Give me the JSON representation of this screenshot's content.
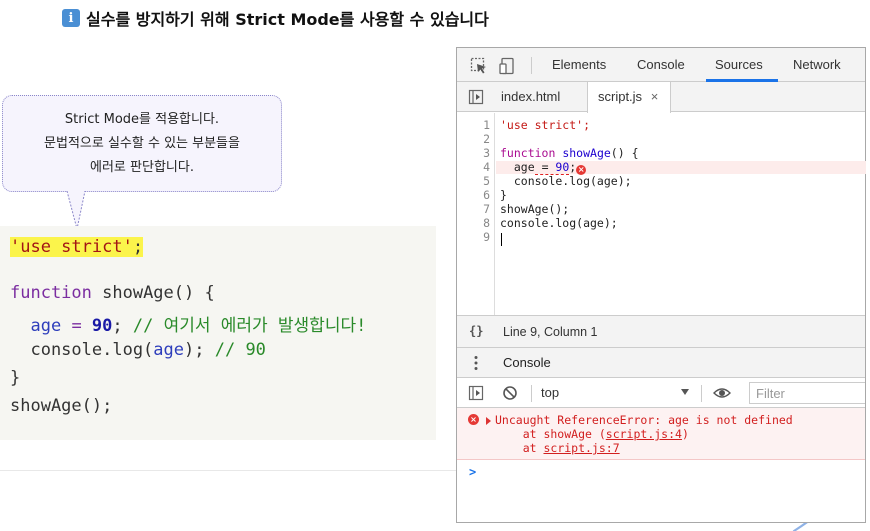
{
  "title": {
    "icon": "info-icon",
    "text": "실수를 방지하기 위해 Strict Mode를 사용할 수 있습니다"
  },
  "bubble": {
    "lines": [
      "Strict Mode를 적용합니다.",
      "문법적으로 실수할 수 있는 부분들을",
      "에러로 판단합니다."
    ]
  },
  "code": {
    "l1_str": "'use strict'",
    "l1_semi": ";",
    "l2_kw": "function",
    "l2_rest": " showAge() {",
    "l3_indent": "  ",
    "l3_var": "age",
    "l3_eq": " = ",
    "l3_num": "90",
    "l3_semi": "; ",
    "l3_cmt": "// 여기서 에러가 발생합니다!",
    "l4_a": "  console.log(",
    "l4_var": "age",
    "l4_b": "); ",
    "l4_cmt": "// 90",
    "l5": "}",
    "l6": "showAge();"
  },
  "devtools": {
    "tabs": [
      "Elements",
      "Console",
      "Sources",
      "Network"
    ],
    "active_tab": "Sources",
    "files": [
      "index.html",
      "script.js"
    ],
    "active_file": "script.js",
    "close_glyph": "×",
    "gutter": [
      "1",
      "2",
      "3",
      "4",
      "5",
      "6",
      "7",
      "8",
      "9"
    ],
    "editor": {
      "l1": "'use strict';",
      "l3_kw": "function",
      "l3_fn": "showAge",
      "l3_rest": "() {",
      "l4_a": "  ",
      "l4_var": "age",
      "l4_eq": " = ",
      "l4_num": "90",
      "l4_semi": ";",
      "l5": "  console.log(age);",
      "l6": "}",
      "l7": "showAge();",
      "l8": "console.log(age);"
    },
    "error_dot_glyph": "×",
    "status_brace": "{}",
    "status": "Line 9, Column 1",
    "console_tab": "Console",
    "context": "top",
    "filter_placeholder": "Filter",
    "error": {
      "line1": "Uncaught ReferenceError: age is not defined",
      "line2_pre": "    at showAge (",
      "line2_link": "script.js:4",
      "line2_post": ")",
      "line3_pre": "    at ",
      "line3_link": "script.js:7"
    },
    "prompt": ">"
  },
  "colors": {
    "highlight": "#fbf44b",
    "keyword": "#7b2da0",
    "comment": "#2a8a2a",
    "error": "#d21f1f",
    "active_tab": "#1a73e8"
  }
}
